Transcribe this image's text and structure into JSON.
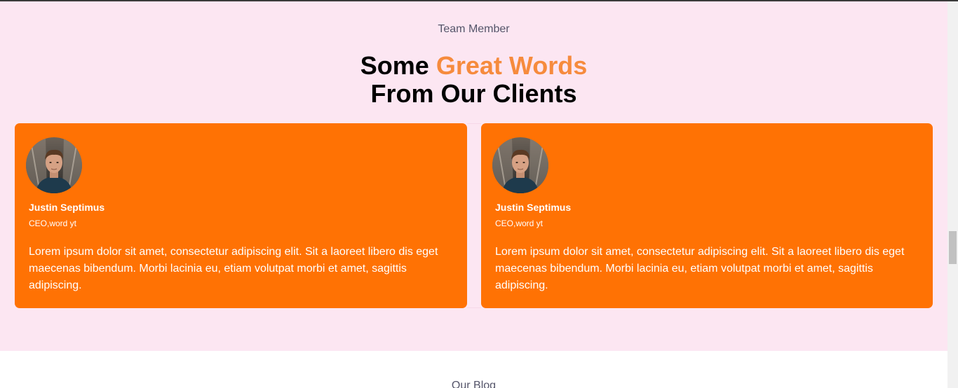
{
  "testimonials": {
    "eyebrow": "Team Member",
    "heading_part1": "Some ",
    "heading_accent": "Great Words",
    "heading_line2": "From Our Clients",
    "accent_color": "#f68b3d",
    "card_color": "#ff7204",
    "background_color": "#fce6f2",
    "cards": [
      {
        "name": "Justin Septimus",
        "role": "CEO,word yt",
        "quote": "Lorem ipsum dolor sit amet, consectetur adipiscing elit. Sit a laoreet libero dis eget maecenas bibendum. Morbi lacinia eu, etiam volutpat morbi et amet, sagittis adipiscing.",
        "avatar_icon": "person-photo"
      },
      {
        "name": "Justin Septimus",
        "role": "CEO,word yt",
        "quote": "Lorem ipsum dolor sit amet, consectetur adipiscing elit. Sit a laoreet libero dis eget maecenas bibendum. Morbi lacinia eu, etiam volutpat morbi et amet, sagittis adipiscing.",
        "avatar_icon": "person-photo"
      }
    ]
  },
  "blog": {
    "eyebrow": "Our Blog"
  }
}
